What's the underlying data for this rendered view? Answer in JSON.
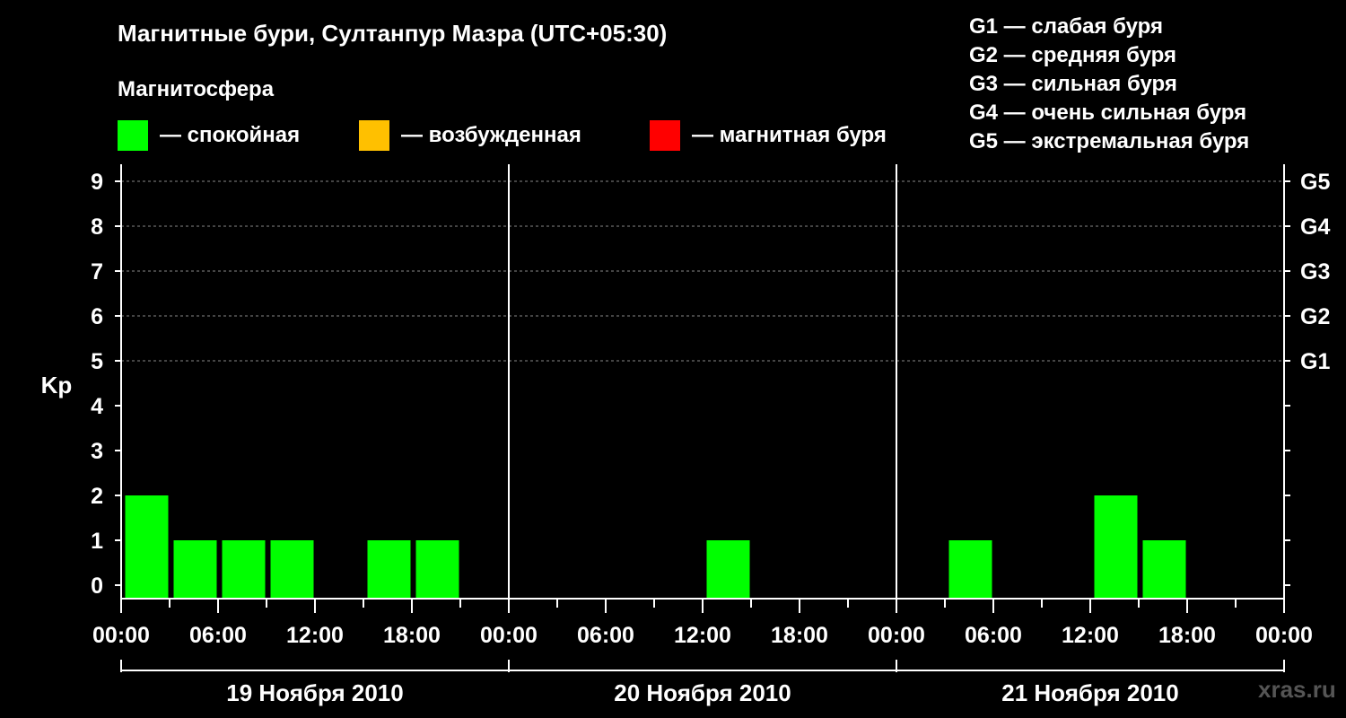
{
  "title": "Магнитные бури, Султанпур Мазра (UTC+05:30)",
  "subtitle": "Магнитосфера",
  "legend": [
    {
      "label": "— спокойная",
      "color": "#00ff00"
    },
    {
      "label": "— возбужденная",
      "color": "#ffc000"
    },
    {
      "label": "— магнитная буря",
      "color": "#ff0000"
    }
  ],
  "g_legend": [
    "G1 — слабая буря",
    "G2 — средняя буря",
    "G3 — сильная буря",
    "G4 — очень сильная буря",
    "G5 — экстремальная буря"
  ],
  "watermark": "xras.ru",
  "chart_data": {
    "type": "bar",
    "ylabel": "Kp",
    "ylim": [
      0,
      9
    ],
    "y_ticks": [
      "0",
      "1",
      "2",
      "3",
      "4",
      "5",
      "6",
      "7",
      "8",
      "9"
    ],
    "g_levels": [
      {
        "label": "G1",
        "kp": 5
      },
      {
        "label": "G2",
        "kp": 6
      },
      {
        "label": "G3",
        "kp": 7
      },
      {
        "label": "G4",
        "kp": 8
      },
      {
        "label": "G5",
        "kp": 9
      }
    ],
    "x_ticks": [
      "00:00",
      "06:00",
      "12:00",
      "18:00",
      "00:00",
      "06:00",
      "12:00",
      "18:00",
      "00:00",
      "06:00",
      "12:00",
      "18:00",
      "00:00"
    ],
    "days": [
      "19 Ноября 2010",
      "20 Ноября 2010",
      "21 Ноября 2010"
    ],
    "grid": true,
    "colors": {
      "quiet": "#00ff00",
      "active": "#ffc000",
      "storm": "#ff0000",
      "grid": "#888888",
      "axis": "#ffffff"
    },
    "series": [
      {
        "day": 0,
        "values": [
          2,
          1,
          1,
          1,
          0,
          1,
          1,
          0
        ]
      },
      {
        "day": 1,
        "values": [
          0,
          0,
          0,
          0,
          1,
          0,
          0,
          0
        ]
      },
      {
        "day": 2,
        "values": [
          0,
          1,
          0,
          0,
          2,
          1,
          0,
          0
        ]
      }
    ]
  }
}
